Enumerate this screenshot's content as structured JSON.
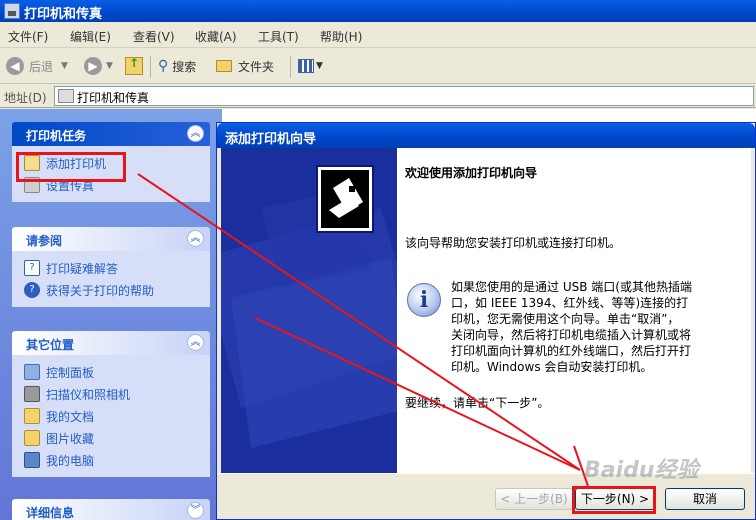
{
  "window": {
    "title": "打印机和传真"
  },
  "menu": [
    "文件(F)",
    "编辑(E)",
    "查看(V)",
    "收藏(A)",
    "工具(T)",
    "帮助(H)"
  ],
  "toolbar": {
    "back": "后退",
    "search": "搜索",
    "folders": "文件夹"
  },
  "address": {
    "label": "地址(D)",
    "value": "打印机和传真"
  },
  "sidebar": {
    "tasks": {
      "title": "打印机任务",
      "items": [
        "添加打印机",
        "设置传真"
      ]
    },
    "see_also": {
      "title": "请参阅",
      "items": [
        "打印疑难解答",
        "获得关于打印的帮助"
      ]
    },
    "other_places": {
      "title": "其它位置",
      "items": [
        "控制面板",
        "扫描仪和照相机",
        "我的文档",
        "图片收藏",
        "我的电脑"
      ]
    },
    "details": {
      "title": "详细信息"
    }
  },
  "wizard": {
    "title": "添加打印机向导",
    "heading": "欢迎使用添加打印机向导",
    "intro": "该向导帮助您安装打印机或连接打印机。",
    "notes": [
      "如果您使用的是通过 USB 端口(或其他热插端",
      "口，如 IEEE 1394、红外线、等等)连接的打",
      "印机，您无需使用这个向导。单击“取消”，",
      "关闭向导，然后将打印机电缆插入计算机或将",
      "打印机面向计算机的红外线端口，然后打开打",
      "印机。Windows 会自动安装打印机。"
    ],
    "continue": "要继续，请单击“下一步”。",
    "buttons": {
      "back": "< 上一步(B)",
      "next": "下一步(N) >",
      "cancel": "取消"
    }
  },
  "watermark": "Baidu经验",
  "colors": {
    "highlight": "#e8141c",
    "xp_blue": "#0a5ee6",
    "link": "#215dc6"
  }
}
